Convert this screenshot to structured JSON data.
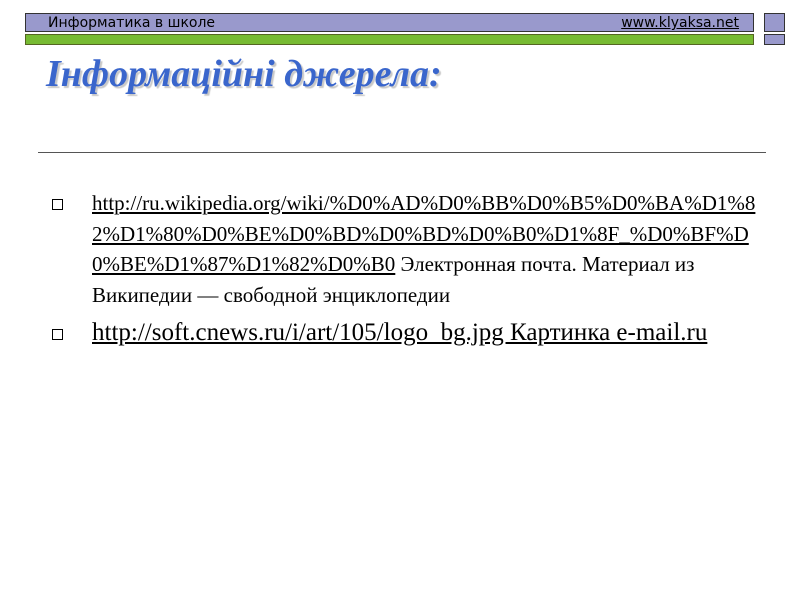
{
  "header": {
    "title": "Информатика в школе",
    "site_link": "www.klyaksa.net"
  },
  "page_title": "Інформаційні джерела:",
  "sources": [
    {
      "url": "http://ru.wikipedia.org/wiki/%D0%AD%D0%BB%D0%B5%D0%BA%D1%82%D1%80%D0%BE%D0%BD%D0%BD%D0%B0%D1%8F_%D0%BF%D0%BE%D1%87%D1%82%D0%B0",
      "description": " Электронная почта. Материал из Википедии — свободной энциклопедии"
    },
    {
      "url": "http://soft.cnews.ru/i/art/105/logo_bg.jpg Картинка e-mail.ru",
      "description": ""
    }
  ],
  "colors": {
    "header_bar": "#9999cc",
    "green_strip": "#77bb33",
    "title": "#3a66cc"
  }
}
